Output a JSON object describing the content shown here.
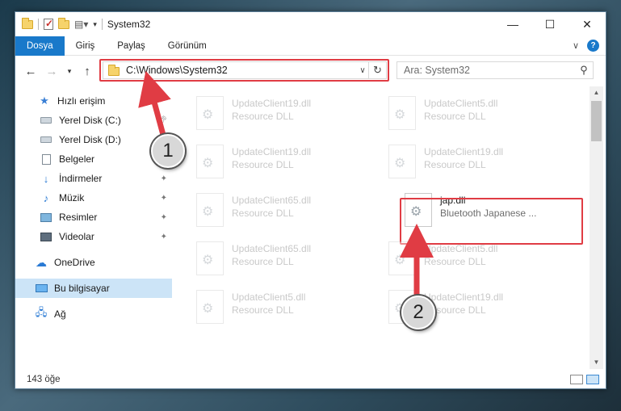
{
  "window": {
    "title": "System32",
    "controls": {
      "minimize": "—",
      "maximize": "☐",
      "close": "✕"
    }
  },
  "ribbon": {
    "tabs": [
      {
        "label": "Dosya",
        "active": true
      },
      {
        "label": "Giriş"
      },
      {
        "label": "Paylaş"
      },
      {
        "label": "Görünüm"
      }
    ]
  },
  "address": {
    "path": "C:\\Windows\\System32",
    "search_placeholder": "Ara: System32"
  },
  "sidebar": {
    "items": [
      {
        "label": "Hızlı erişim",
        "icon": "star-icon"
      },
      {
        "label": "Yerel Disk (C:)",
        "icon": "drive-icon",
        "pinned": true
      },
      {
        "label": "Yerel Disk (D:)",
        "icon": "drive-icon"
      },
      {
        "label": "Belgeler",
        "icon": "documents-icon"
      },
      {
        "label": "İndirmeler",
        "icon": "downloads-icon",
        "pinned": true
      },
      {
        "label": "Müzik",
        "icon": "music-icon",
        "pinned": true
      },
      {
        "label": "Resimler",
        "icon": "pictures-icon",
        "pinned": true
      },
      {
        "label": "Videolar",
        "icon": "videos-icon",
        "pinned": true
      },
      {
        "label": "OneDrive",
        "icon": "cloud-icon"
      },
      {
        "label": "Bu bilgisayar",
        "icon": "pc-icon",
        "selected": true
      },
      {
        "label": "Ağ",
        "icon": "network-icon"
      }
    ]
  },
  "files": [
    {
      "name": "UpdateClient19.dll",
      "type": "Resource DLL",
      "faded": true
    },
    {
      "name": "UpdateClient5.dll",
      "type": "Resource DLL",
      "faded": true
    },
    {
      "name": "UpdateClient19.dll",
      "type": "Resource DLL",
      "faded": true
    },
    {
      "name": "UpdateClient19.dll",
      "type": "Resource DLL",
      "faded": true
    },
    {
      "name": "UpdateClient65.dll",
      "type": "Resource DLL",
      "faded": true
    },
    {
      "name": "jap.dll",
      "type": "Bluetooth Japanese ...",
      "faded": false
    },
    {
      "name": "UpdateClient65.dll",
      "type": "Resource DLL",
      "faded": true
    },
    {
      "name": "UpdateClient5.dll",
      "type": "Resource DLL",
      "faded": true
    },
    {
      "name": "UpdateClient5.dll",
      "type": "Resource DLL",
      "faded": true
    },
    {
      "name": "UpdateClient19.dll",
      "type": "Resource DLL",
      "faded": true
    }
  ],
  "status": {
    "item_count": "143 öğe"
  },
  "annotations": {
    "step1": "1",
    "step2": "2",
    "color": "#e03c44"
  }
}
